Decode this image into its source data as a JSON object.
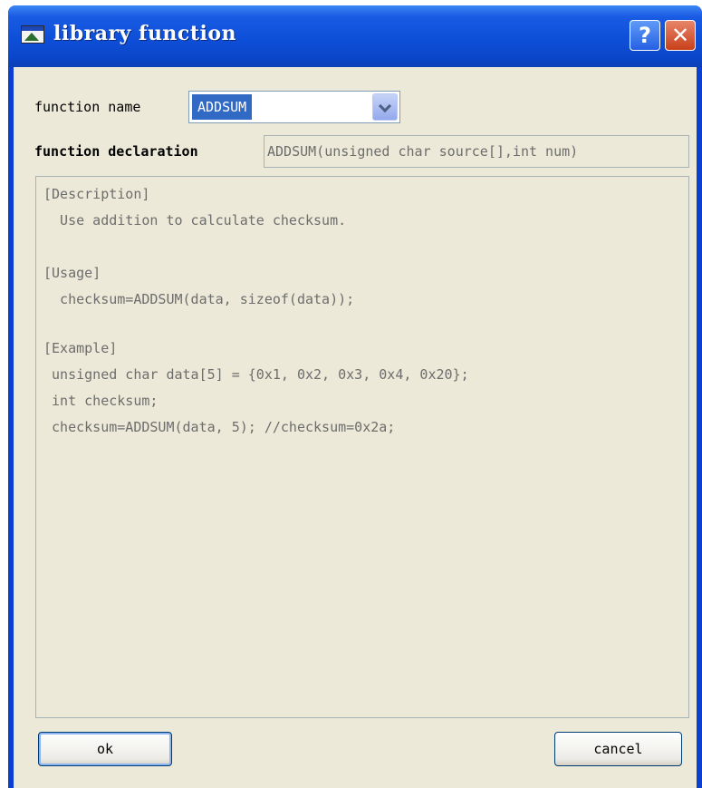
{
  "window": {
    "title": "library function"
  },
  "form": {
    "function_name_label": "function name",
    "function_name_value": "ADDSUM",
    "function_declaration_label": "function declaration",
    "function_declaration_value": "ADDSUM(unsigned char source[],int num)"
  },
  "description": {
    "lines": [
      "[Description]",
      "  Use addition to calculate checksum.",
      "",
      "[Usage]",
      "  checksum=ADDSUM(data, sizeof(data));",
      "",
      "[Example]",
      " unsigned char data[5] = {0x1, 0x2, 0x3, 0x4, 0x20};",
      " int checksum;",
      " checksum=ADDSUM(data, 5); //checksum=0x2a;"
    ]
  },
  "buttons": {
    "ok_label": "ok",
    "cancel_label": "cancel",
    "help_label": "?",
    "close_label": "✕"
  },
  "colors": {
    "titlebar": "#0a46c9",
    "client_bg": "#ece9d8",
    "selection": "#316ac5",
    "disabled_text": "#6d6d6d"
  },
  "icons": [
    "window-icon",
    "help-icon",
    "close-icon",
    "chevron-down-icon"
  ]
}
